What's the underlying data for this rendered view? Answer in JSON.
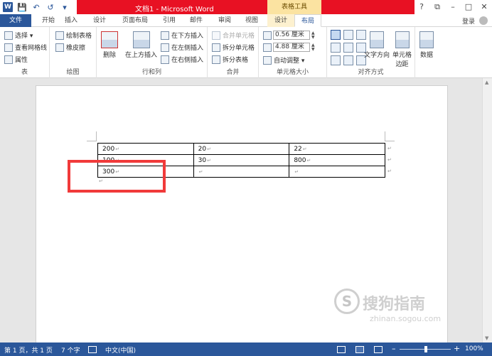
{
  "titlebar": {
    "title": "文档1 - Microsoft Word",
    "context_group": "表格工具",
    "win_help": "?",
    "win_restore": "⧉",
    "win_min": "–",
    "win_max": "□",
    "win_close": "✕",
    "word_icon": "W",
    "save_icon": "💾",
    "undo_icon": "↶",
    "redo_icon": "↺",
    "more_icon": "▾"
  },
  "tabs": {
    "file": "文件",
    "home": "开始",
    "insert": "插入",
    "design": "设计",
    "layout_page": "页面布局",
    "references": "引用",
    "mailings": "邮件",
    "review": "审阅",
    "view": "视图",
    "table_design": "设计",
    "table_layout": "布局",
    "login": "登录"
  },
  "ribbon": {
    "table": {
      "select": "选择 ▾",
      "gridlines": "查看网格线",
      "properties": "属性",
      "label": "表"
    },
    "draw": {
      "draw_table": "绘制表格",
      "eraser": "橡皮擦",
      "label": "绘图"
    },
    "rows_cols": {
      "delete": "删除",
      "insert_above": "在上方插入",
      "insert_below": "在下方插入",
      "insert_left": "在左侧插入",
      "insert_right": "在右侧插入",
      "label": "行和列"
    },
    "merge": {
      "merge_cells": "合并单元格",
      "split_cells": "拆分单元格",
      "split_table": "拆分表格",
      "label": "合并"
    },
    "cell_size": {
      "height": "0.56 厘米",
      "width": "4.88 厘米",
      "autofit": "自动调整 ▾",
      "label": "单元格大小"
    },
    "alignment": {
      "text_direction": "文字方向",
      "cell_margins": "单元格\n边距",
      "label": "对齐方式"
    },
    "data": {
      "label": "数据"
    }
  },
  "document": {
    "table": [
      [
        "200",
        "20",
        "22"
      ],
      [
        "100",
        "30",
        "800"
      ],
      [
        "300",
        "",
        ""
      ]
    ],
    "para_mark": "↵"
  },
  "watermark": {
    "logo": "S",
    "text": "搜狗指南",
    "url": "zhinan.sogou.com"
  },
  "status": {
    "page": "第 1 页，共 1 页",
    "words": "7 个字",
    "language": "中文(中国)",
    "zoom": "100%",
    "zoom_minus": "–",
    "zoom_plus": "+"
  }
}
